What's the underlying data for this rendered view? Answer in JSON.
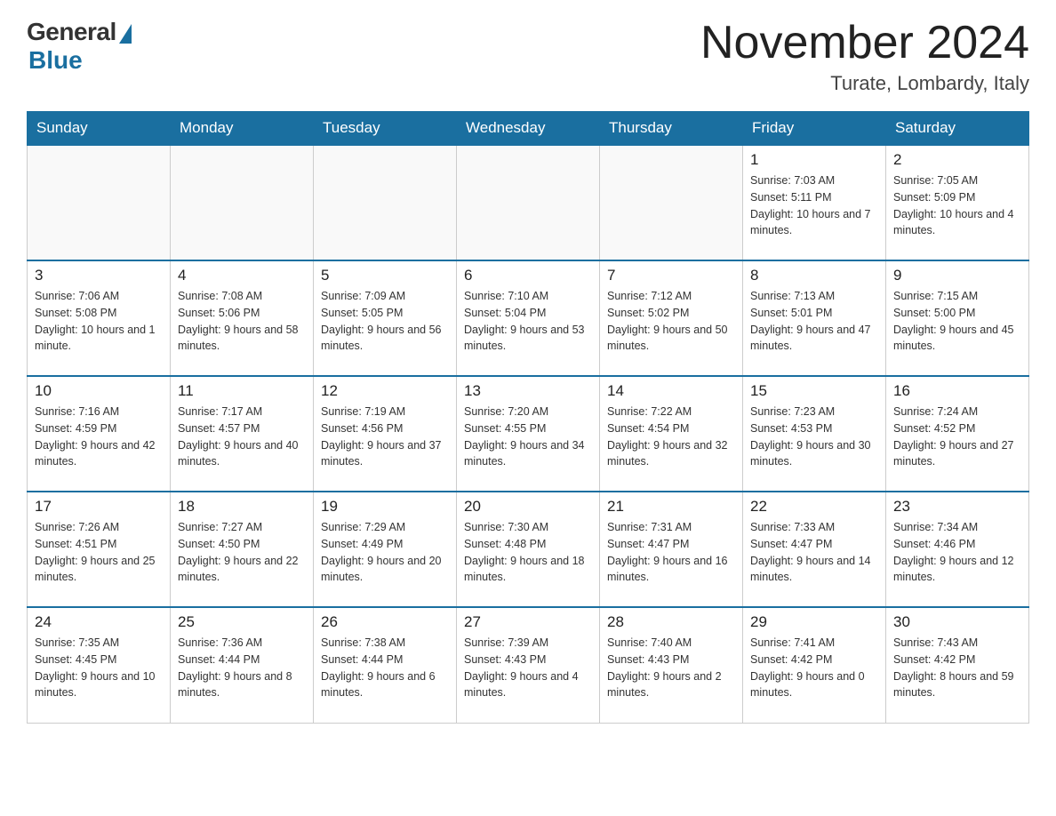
{
  "header": {
    "logo_general": "General",
    "logo_blue": "Blue",
    "month_title": "November 2024",
    "location": "Turate, Lombardy, Italy"
  },
  "days_of_week": [
    "Sunday",
    "Monday",
    "Tuesday",
    "Wednesday",
    "Thursday",
    "Friday",
    "Saturday"
  ],
  "weeks": [
    [
      {
        "day": "",
        "info": ""
      },
      {
        "day": "",
        "info": ""
      },
      {
        "day": "",
        "info": ""
      },
      {
        "day": "",
        "info": ""
      },
      {
        "day": "",
        "info": ""
      },
      {
        "day": "1",
        "info": "Sunrise: 7:03 AM\nSunset: 5:11 PM\nDaylight: 10 hours and 7 minutes."
      },
      {
        "day": "2",
        "info": "Sunrise: 7:05 AM\nSunset: 5:09 PM\nDaylight: 10 hours and 4 minutes."
      }
    ],
    [
      {
        "day": "3",
        "info": "Sunrise: 7:06 AM\nSunset: 5:08 PM\nDaylight: 10 hours and 1 minute."
      },
      {
        "day": "4",
        "info": "Sunrise: 7:08 AM\nSunset: 5:06 PM\nDaylight: 9 hours and 58 minutes."
      },
      {
        "day": "5",
        "info": "Sunrise: 7:09 AM\nSunset: 5:05 PM\nDaylight: 9 hours and 56 minutes."
      },
      {
        "day": "6",
        "info": "Sunrise: 7:10 AM\nSunset: 5:04 PM\nDaylight: 9 hours and 53 minutes."
      },
      {
        "day": "7",
        "info": "Sunrise: 7:12 AM\nSunset: 5:02 PM\nDaylight: 9 hours and 50 minutes."
      },
      {
        "day": "8",
        "info": "Sunrise: 7:13 AM\nSunset: 5:01 PM\nDaylight: 9 hours and 47 minutes."
      },
      {
        "day": "9",
        "info": "Sunrise: 7:15 AM\nSunset: 5:00 PM\nDaylight: 9 hours and 45 minutes."
      }
    ],
    [
      {
        "day": "10",
        "info": "Sunrise: 7:16 AM\nSunset: 4:59 PM\nDaylight: 9 hours and 42 minutes."
      },
      {
        "day": "11",
        "info": "Sunrise: 7:17 AM\nSunset: 4:57 PM\nDaylight: 9 hours and 40 minutes."
      },
      {
        "day": "12",
        "info": "Sunrise: 7:19 AM\nSunset: 4:56 PM\nDaylight: 9 hours and 37 minutes."
      },
      {
        "day": "13",
        "info": "Sunrise: 7:20 AM\nSunset: 4:55 PM\nDaylight: 9 hours and 34 minutes."
      },
      {
        "day": "14",
        "info": "Sunrise: 7:22 AM\nSunset: 4:54 PM\nDaylight: 9 hours and 32 minutes."
      },
      {
        "day": "15",
        "info": "Sunrise: 7:23 AM\nSunset: 4:53 PM\nDaylight: 9 hours and 30 minutes."
      },
      {
        "day": "16",
        "info": "Sunrise: 7:24 AM\nSunset: 4:52 PM\nDaylight: 9 hours and 27 minutes."
      }
    ],
    [
      {
        "day": "17",
        "info": "Sunrise: 7:26 AM\nSunset: 4:51 PM\nDaylight: 9 hours and 25 minutes."
      },
      {
        "day": "18",
        "info": "Sunrise: 7:27 AM\nSunset: 4:50 PM\nDaylight: 9 hours and 22 minutes."
      },
      {
        "day": "19",
        "info": "Sunrise: 7:29 AM\nSunset: 4:49 PM\nDaylight: 9 hours and 20 minutes."
      },
      {
        "day": "20",
        "info": "Sunrise: 7:30 AM\nSunset: 4:48 PM\nDaylight: 9 hours and 18 minutes."
      },
      {
        "day": "21",
        "info": "Sunrise: 7:31 AM\nSunset: 4:47 PM\nDaylight: 9 hours and 16 minutes."
      },
      {
        "day": "22",
        "info": "Sunrise: 7:33 AM\nSunset: 4:47 PM\nDaylight: 9 hours and 14 minutes."
      },
      {
        "day": "23",
        "info": "Sunrise: 7:34 AM\nSunset: 4:46 PM\nDaylight: 9 hours and 12 minutes."
      }
    ],
    [
      {
        "day": "24",
        "info": "Sunrise: 7:35 AM\nSunset: 4:45 PM\nDaylight: 9 hours and 10 minutes."
      },
      {
        "day": "25",
        "info": "Sunrise: 7:36 AM\nSunset: 4:44 PM\nDaylight: 9 hours and 8 minutes."
      },
      {
        "day": "26",
        "info": "Sunrise: 7:38 AM\nSunset: 4:44 PM\nDaylight: 9 hours and 6 minutes."
      },
      {
        "day": "27",
        "info": "Sunrise: 7:39 AM\nSunset: 4:43 PM\nDaylight: 9 hours and 4 minutes."
      },
      {
        "day": "28",
        "info": "Sunrise: 7:40 AM\nSunset: 4:43 PM\nDaylight: 9 hours and 2 minutes."
      },
      {
        "day": "29",
        "info": "Sunrise: 7:41 AM\nSunset: 4:42 PM\nDaylight: 9 hours and 0 minutes."
      },
      {
        "day": "30",
        "info": "Sunrise: 7:43 AM\nSunset: 4:42 PM\nDaylight: 8 hours and 59 minutes."
      }
    ]
  ]
}
